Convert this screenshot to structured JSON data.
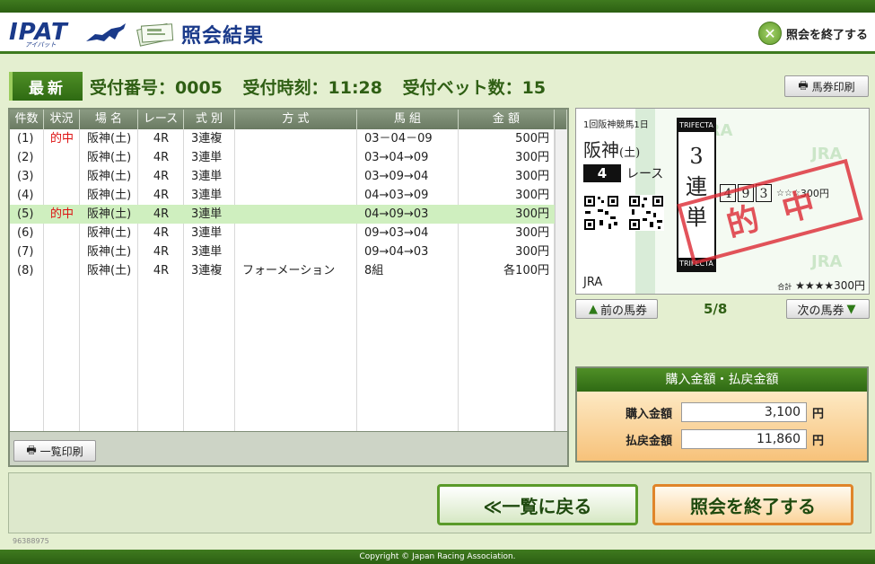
{
  "app": {
    "logo": "IPAT",
    "logo_sub": "アイパット",
    "title": "照会結果",
    "exit_top_label": "照会を終了する"
  },
  "info": {
    "latest_label": "最新",
    "receipt_number": "受付番号：0005",
    "receipt_time": "受付時刻：11:28",
    "bet_count": "受付ベット数：15"
  },
  "print_ticket_label": "馬券印刷",
  "table": {
    "headers": [
      "件数",
      "状況",
      "場 名",
      "レース",
      "式 別",
      "方 式",
      "馬 組",
      "金 額"
    ],
    "rows": [
      {
        "no": "(1)",
        "status": "的中",
        "venue": "阪神(土)",
        "race": "4R",
        "type": "3連複",
        "method": "",
        "combo": "03－04－09",
        "amount": "500円"
      },
      {
        "no": "(2)",
        "status": "",
        "venue": "阪神(土)",
        "race": "4R",
        "type": "3連単",
        "method": "",
        "combo": "03→04→09",
        "amount": "300円"
      },
      {
        "no": "(3)",
        "status": "",
        "venue": "阪神(土)",
        "race": "4R",
        "type": "3連単",
        "method": "",
        "combo": "03→09→04",
        "amount": "300円"
      },
      {
        "no": "(4)",
        "status": "",
        "venue": "阪神(土)",
        "race": "4R",
        "type": "3連単",
        "method": "",
        "combo": "04→03→09",
        "amount": "300円"
      },
      {
        "no": "(5)",
        "status": "的中",
        "venue": "阪神(土)",
        "race": "4R",
        "type": "3連単",
        "method": "",
        "combo": "04→09→03",
        "amount": "300円"
      },
      {
        "no": "(6)",
        "status": "",
        "venue": "阪神(土)",
        "race": "4R",
        "type": "3連単",
        "method": "",
        "combo": "09→03→04",
        "amount": "300円"
      },
      {
        "no": "(7)",
        "status": "",
        "venue": "阪神(土)",
        "race": "4R",
        "type": "3連単",
        "method": "",
        "combo": "09→04→03",
        "amount": "300円"
      },
      {
        "no": "(8)",
        "status": "",
        "venue": "阪神(土)",
        "race": "4R",
        "type": "3連複",
        "method": "フォーメーション",
        "combo": "8組",
        "amount": "各100円"
      }
    ],
    "list_print_label": "一覧印刷"
  },
  "ticket": {
    "meeting": "1回阪神競馬1日",
    "venue": "阪神",
    "day": "(土)",
    "race_number": "4",
    "race_suffix": "レース",
    "band_label": "TRIFECTA",
    "kind": [
      "3",
      "連",
      "単"
    ],
    "numbers": [
      "4",
      "9",
      "3"
    ],
    "stars": "☆☆☆",
    "combo_amount": "300円",
    "stamp": "的中",
    "jra": "JRA",
    "total_label": "合計",
    "total_stars": "★★★★",
    "total_amount": "300円",
    "watermark": "JRA"
  },
  "ticket_nav": {
    "prev_label": "前の馬券",
    "next_label": "次の馬券",
    "page": "5/8"
  },
  "totals": {
    "header": "購入金額・払戻金額",
    "purchase_label": "購入金額",
    "purchase_value": "3,100",
    "payout_label": "払戻金額",
    "payout_value": "11,860",
    "unit": "円"
  },
  "buttons": {
    "back_label": "≪一覧に戻る",
    "exit_label": "照会を終了する"
  },
  "footer": {
    "id": "96388975",
    "copyright": "Copyright © Japan Racing Association."
  }
}
